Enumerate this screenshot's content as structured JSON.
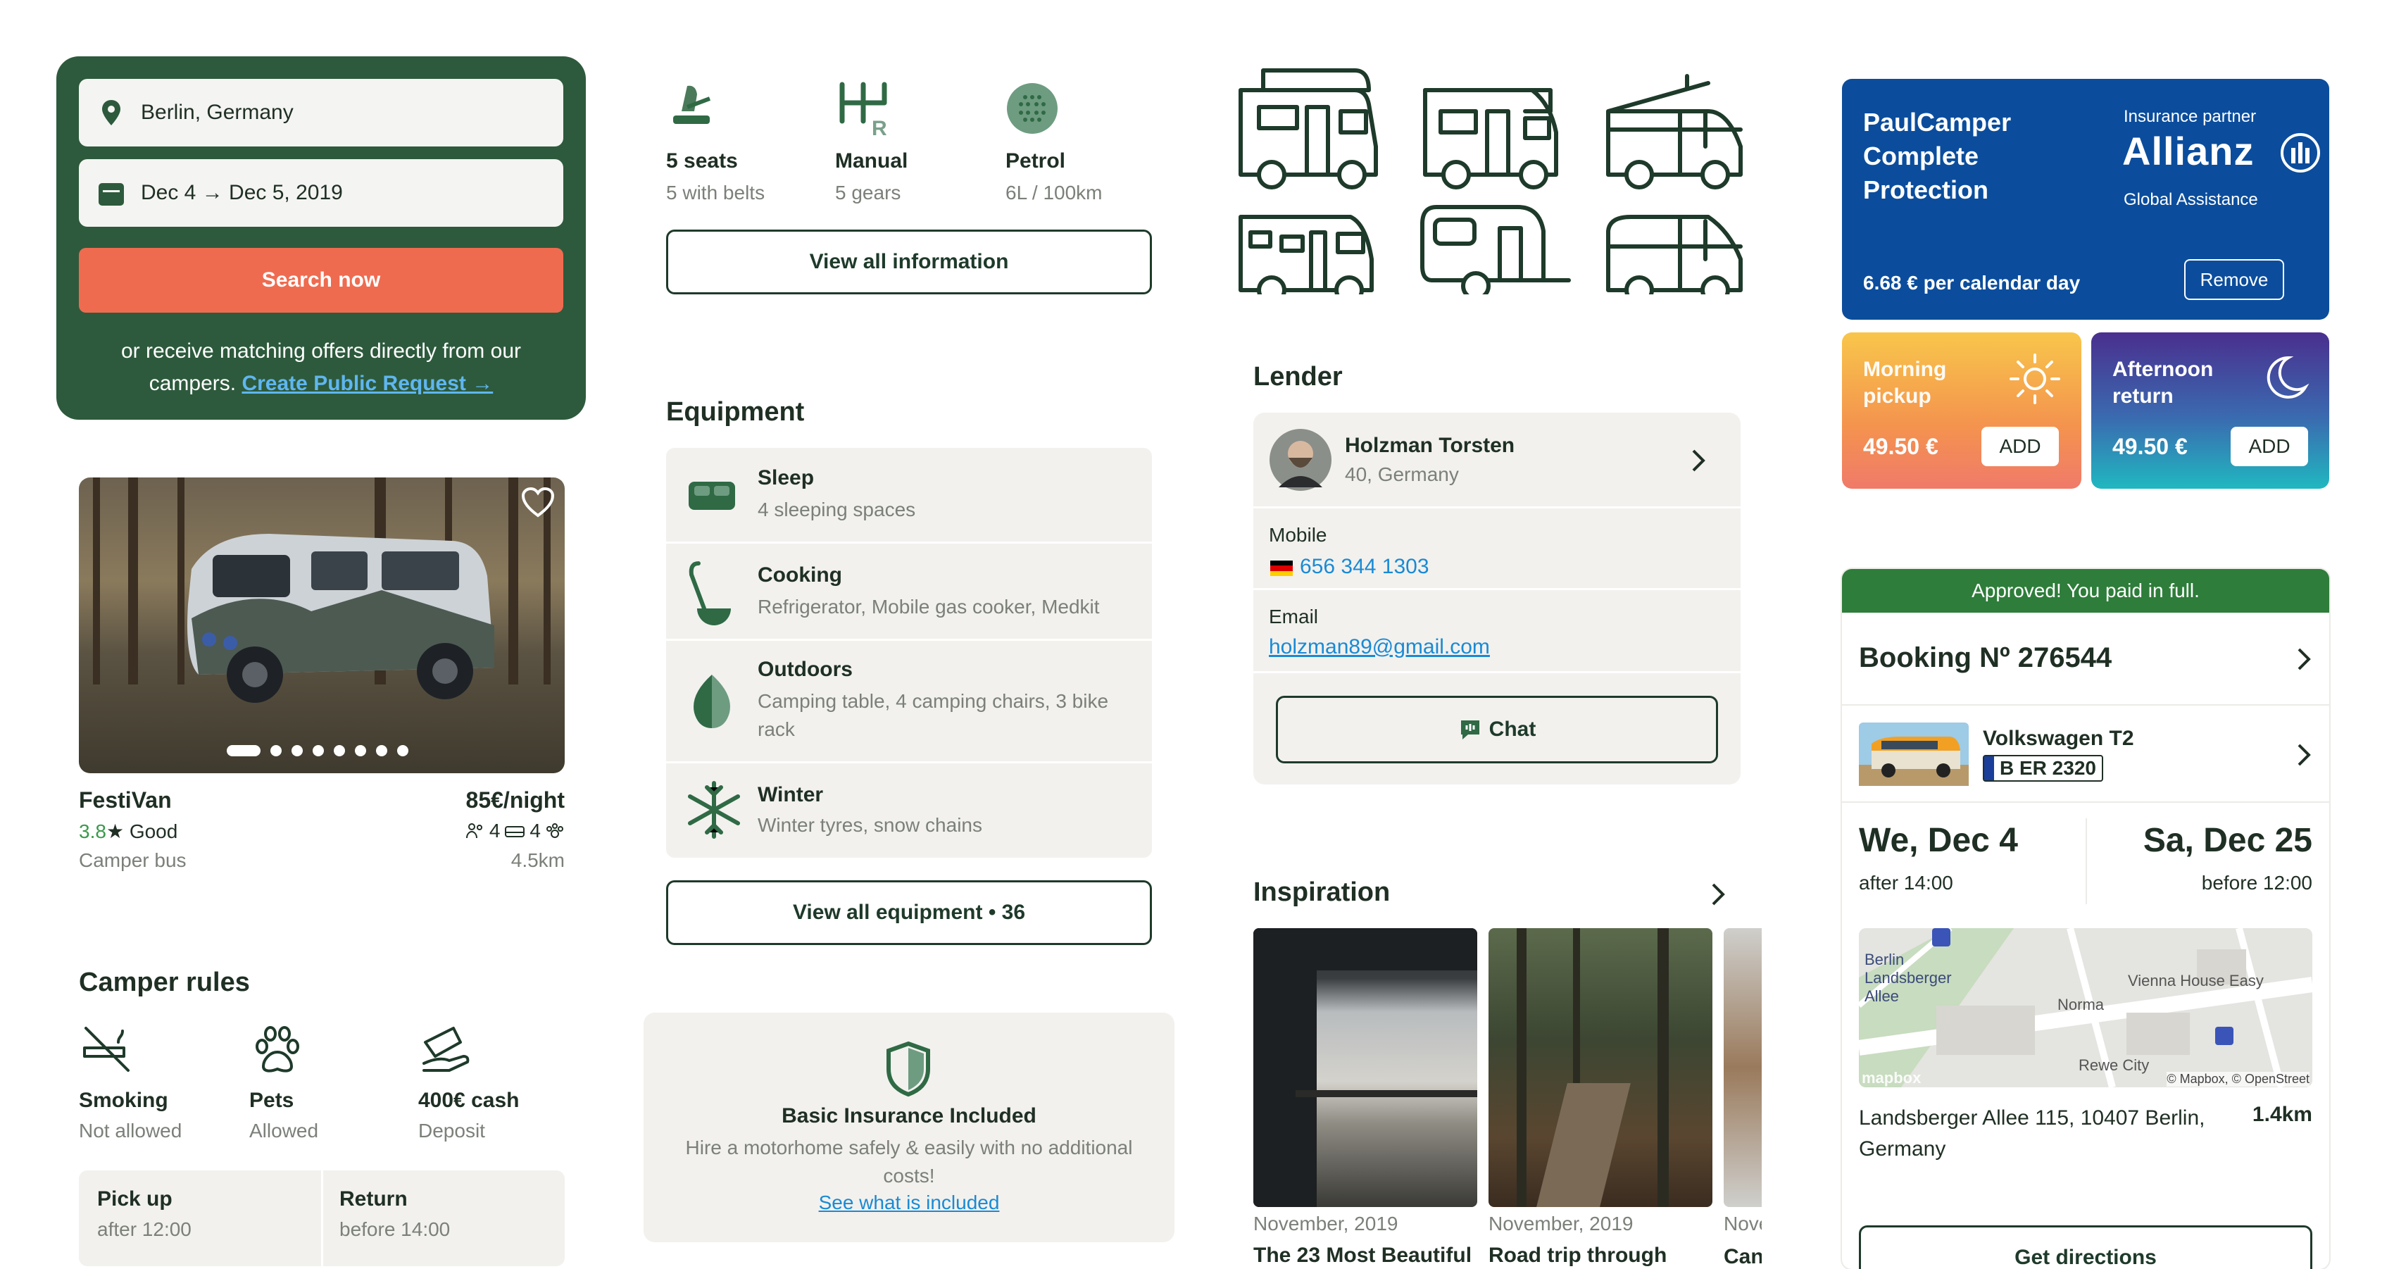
{
  "search": {
    "location": "Berlin, Germany",
    "dates": "Dec 4 → Dec 5, 2019",
    "button": "Search now",
    "note_line1": "or receive matching offers directly from our",
    "note_line2": "campers. ",
    "note_link": "Create Public Request →"
  },
  "listing": {
    "name": "FestiVan",
    "price": "85€/night",
    "rating": "3.8",
    "rating_star": "★",
    "rating_text": "Good",
    "type": "Camper bus",
    "seats": "4",
    "beds": "4",
    "distance": "4.5km",
    "carousel_count": 8,
    "carousel_active": 0
  },
  "rules": {
    "title": "Camper rules",
    "items": [
      {
        "label": "Smoking",
        "sub": "Not allowed",
        "icon": "no-smoking-icon"
      },
      {
        "label": "Pets",
        "sub": "Allowed",
        "icon": "paw-icon"
      },
      {
        "label": "400€ cash",
        "sub": "Deposit",
        "icon": "cash-hand-icon"
      }
    ],
    "pickup_label": "Pick up",
    "pickup_time": "after 12:00",
    "return_label": "Return",
    "return_time": "before 14:00"
  },
  "specs": {
    "items": [
      {
        "label": "5 seats",
        "sub": "5 with belts",
        "icon": "seat-icon"
      },
      {
        "label": "Manual",
        "sub": "5 gears",
        "icon": "gearshift-icon"
      },
      {
        "label": "Petrol",
        "sub": "6L / 100km",
        "icon": "fuel-icon"
      }
    ],
    "view_all": "View all information"
  },
  "equipment": {
    "title": "Equipment",
    "items": [
      {
        "label": "Sleep",
        "sub": "4 sleeping spaces",
        "icon": "bed-icon"
      },
      {
        "label": "Cooking",
        "sub": "Refrigerator, Mobile gas cooker, Medkit",
        "icon": "ladle-icon"
      },
      {
        "label": "Outdoors",
        "sub": "Camping table, 4 camping chairs, 3 bike rack",
        "icon": "leaf-icon"
      },
      {
        "label": "Winter",
        "sub": "Winter tyres, snow chains",
        "icon": "snowflake-icon"
      }
    ],
    "view_all": "View all equipment • 36"
  },
  "insurance_basic": {
    "title": "Basic Insurance Included",
    "text": "Hire a motorhome safely & easily with no additional costs!",
    "link": "See what is included"
  },
  "lender": {
    "title": "Lender",
    "name": "Holzman Torsten",
    "meta": "40, Germany",
    "mobile_label": "Mobile",
    "mobile": "656 344 1303",
    "email_label": "Email",
    "email": "holzman89@gmail.com",
    "chat": "Chat"
  },
  "inspiration": {
    "title": "Inspiration",
    "articles": [
      {
        "date": "November, 2019",
        "title": "The 23 Most Beautiful"
      },
      {
        "date": "November, 2019",
        "title": "Road trip through"
      },
      {
        "date": "Nove",
        "title": "Can"
      }
    ]
  },
  "protection": {
    "title_line1": "PaulCamper",
    "title_line2": "Complete",
    "title_line3": "Protection",
    "partner_label": "Insurance partner",
    "partner": "Allianz",
    "partner_sub": "Global Assistance",
    "price": "6.68 € per calendar day",
    "remove": "Remove"
  },
  "addons": {
    "morning_title": "Morning pickup",
    "morning_price": "49.50 €",
    "afternoon_title": "Afternoon return",
    "afternoon_price": "49.50 €",
    "add": "ADD"
  },
  "booking": {
    "status": "Approved! You paid in full.",
    "number": "Booking Nº 276544",
    "vehicle": "Volkswagen T2",
    "plate": "B ER 2320",
    "start_date": "We, Dec 4",
    "start_time": "after 14:00",
    "end_date": "Sa, Dec 25",
    "end_time": "before 12:00",
    "map_labels": {
      "station": "Berlin Landsberger Allee",
      "poi1": "Vienna House Easy",
      "poi2": "Norma",
      "poi3": "Rewe City",
      "attrib": "© Mapbox, © OpenStreet",
      "logo": "mapbox"
    },
    "address": "Landsberger Allee 115, 10407 Berlin, Germany",
    "distance": "1.4km",
    "directions": "Get directions"
  },
  "colors": {
    "brand_green": "#2d5a3c",
    "accent_orange": "#ef6b4f",
    "link_blue": "#1a8ad4",
    "allianz_blue": "#0b4d9c",
    "approved_green": "#2e7d3a"
  }
}
